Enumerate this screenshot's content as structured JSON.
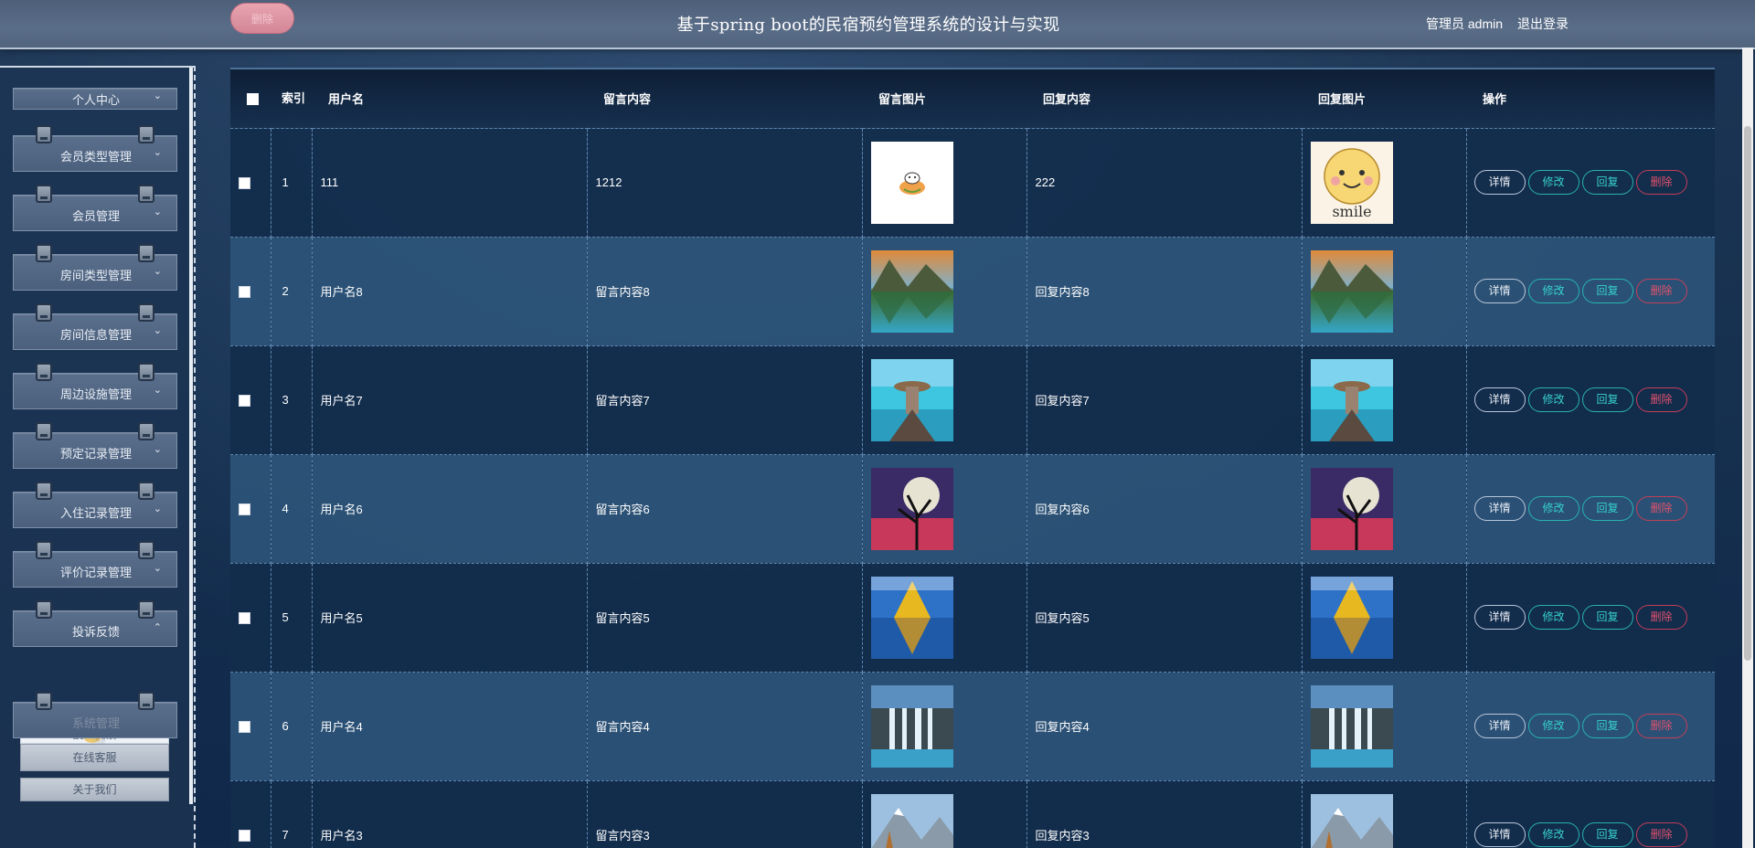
{
  "header": {
    "delete_label": "删除",
    "title": "基于spring boot的民宿预约管理系统的设计与实现",
    "user_label": "管理员 admin",
    "logout_label": "退出登录"
  },
  "sidebar": {
    "items": [
      {
        "label": "个人中心",
        "chev": "⌄"
      },
      {
        "label": "会员类型管理",
        "chev": "⌄"
      },
      {
        "label": "会员管理",
        "chev": "⌄"
      },
      {
        "label": "房间类型管理",
        "chev": "⌄"
      },
      {
        "label": "房间信息管理",
        "chev": "⌄"
      },
      {
        "label": "周边设施管理",
        "chev": "⌄"
      },
      {
        "label": "预定记录管理",
        "chev": "⌄"
      },
      {
        "label": "入住记录管理",
        "chev": "⌄"
      },
      {
        "label": "评价记录管理",
        "chev": "⌄"
      },
      {
        "label": "投诉反馈",
        "chev": "⌃"
      },
      {
        "label": "系统管理",
        "chev": ""
      }
    ],
    "submenu_label": "投诉反馈",
    "online_service_label": "在线客服",
    "about_label": "关于我们"
  },
  "table": {
    "columns": [
      "索引",
      "用户名",
      "留言内容",
      "留言图片",
      "回复内容",
      "回复图片",
      "操作"
    ],
    "rows": [
      {
        "index": "1",
        "username": "111",
        "content": "1212",
        "reply": "222",
        "image": "rabbit",
        "reply_image": "smile"
      },
      {
        "index": "2",
        "username": "用户名8",
        "content": "留言内容8",
        "reply": "回复内容8",
        "image": "lake",
        "reply_image": "lake"
      },
      {
        "index": "3",
        "username": "用户名7",
        "content": "留言内容7",
        "reply": "回复内容7",
        "image": "beach",
        "reply_image": "beach"
      },
      {
        "index": "4",
        "username": "用户名6",
        "content": "留言内容6",
        "reply": "回复内容6",
        "image": "moon",
        "reply_image": "moon"
      },
      {
        "index": "5",
        "username": "用户名5",
        "content": "留言内容5",
        "reply": "回复内容5",
        "image": "autumn",
        "reply_image": "autumn"
      },
      {
        "index": "6",
        "username": "用户名4",
        "content": "留言内容4",
        "reply": "回复内容4",
        "image": "waterfall",
        "reply_image": "waterfall"
      },
      {
        "index": "7",
        "username": "用户名3",
        "content": "留言内容3",
        "reply": "回复内容3",
        "image": "mountain",
        "reply_image": "mountain"
      }
    ],
    "actions": {
      "detail": "详情",
      "edit": "修改",
      "reply": "回复",
      "delete": "删除"
    }
  }
}
